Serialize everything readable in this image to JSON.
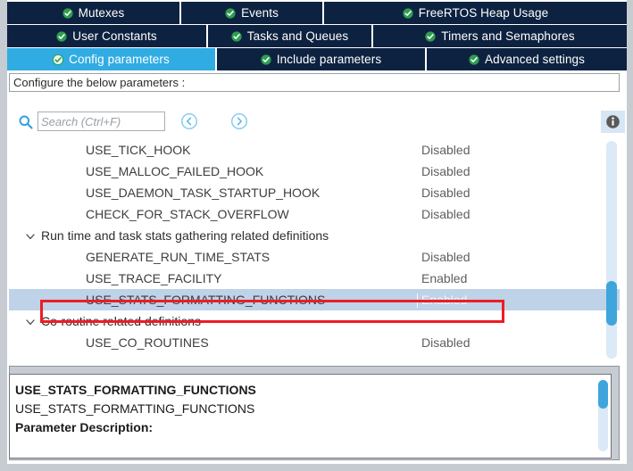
{
  "tabs": {
    "rows": [
      [
        {
          "label": "Mutexes",
          "icon": "check-circle-icon",
          "active": false
        },
        {
          "label": "Events",
          "icon": "check-circle-icon",
          "active": false
        },
        {
          "label": "FreeRTOS Heap Usage",
          "icon": "check-circle-icon",
          "active": false
        }
      ],
      [
        {
          "label": "User Constants",
          "icon": "check-circle-icon",
          "active": false
        },
        {
          "label": "Tasks and Queues",
          "icon": "check-circle-icon",
          "active": false
        },
        {
          "label": "Timers and Semaphores",
          "icon": "check-circle-icon",
          "active": false
        }
      ],
      [
        {
          "label": "Config parameters",
          "icon": "check-circle-icon",
          "active": true
        },
        {
          "label": "Include parameters",
          "icon": "check-circle-icon",
          "active": false
        },
        {
          "label": "Advanced settings",
          "icon": "check-circle-icon",
          "active": false
        }
      ]
    ]
  },
  "configure_bar": {
    "text": "Configure the below parameters :"
  },
  "search": {
    "placeholder": "Search (Ctrl+F)",
    "value": "",
    "icon": "search-icon",
    "prev_icon": "chevron-left-circle-icon",
    "next_icon": "chevron-right-circle-icon",
    "info_icon": "info-icon"
  },
  "param_list": {
    "rows": [
      {
        "type": "param",
        "name": "USE_TICK_HOOK",
        "value": "Disabled",
        "selected": false
      },
      {
        "type": "param",
        "name": "USE_MALLOC_FAILED_HOOK",
        "value": "Disabled",
        "selected": false
      },
      {
        "type": "param",
        "name": "USE_DAEMON_TASK_STARTUP_HOOK",
        "value": "Disabled",
        "selected": false
      },
      {
        "type": "param",
        "name": "CHECK_FOR_STACK_OVERFLOW",
        "value": "Disabled",
        "selected": false
      },
      {
        "type": "group",
        "name": "Run time and task stats gathering related definitions",
        "chevron": "chevron-down-icon"
      },
      {
        "type": "param",
        "name": "GENERATE_RUN_TIME_STATS",
        "value": "Disabled",
        "selected": false
      },
      {
        "type": "param",
        "name": "USE_TRACE_FACILITY",
        "value": "Enabled",
        "selected": false
      },
      {
        "type": "param",
        "name": "USE_STATS_FORMATTING_FUNCTIONS",
        "value": "Enabled",
        "selected": true
      },
      {
        "type": "group",
        "name": "Co-routine related definitions",
        "chevron": "chevron-down-icon"
      },
      {
        "type": "param",
        "name": "USE_CO_ROUTINES",
        "value": "Disabled",
        "selected": false
      }
    ]
  },
  "annotation": {
    "color": "#ee1c23",
    "target": "USE_STATS_FORMATTING_FUNCTIONS"
  },
  "description": {
    "title": "USE_STATS_FORMATTING_FUNCTIONS",
    "subtitle": "USE_STATS_FORMATTING_FUNCTIONS",
    "section_label": "Parameter Description:"
  },
  "colors": {
    "tab_inactive_bg": "#0d2240",
    "tab_active_bg": "#30ace3",
    "selection_bg": "#bed2e8",
    "scrollbar_thumb": "#3fa5dc",
    "frame_bg": "#c7ccd3",
    "check_green": "#2e9e4f"
  }
}
